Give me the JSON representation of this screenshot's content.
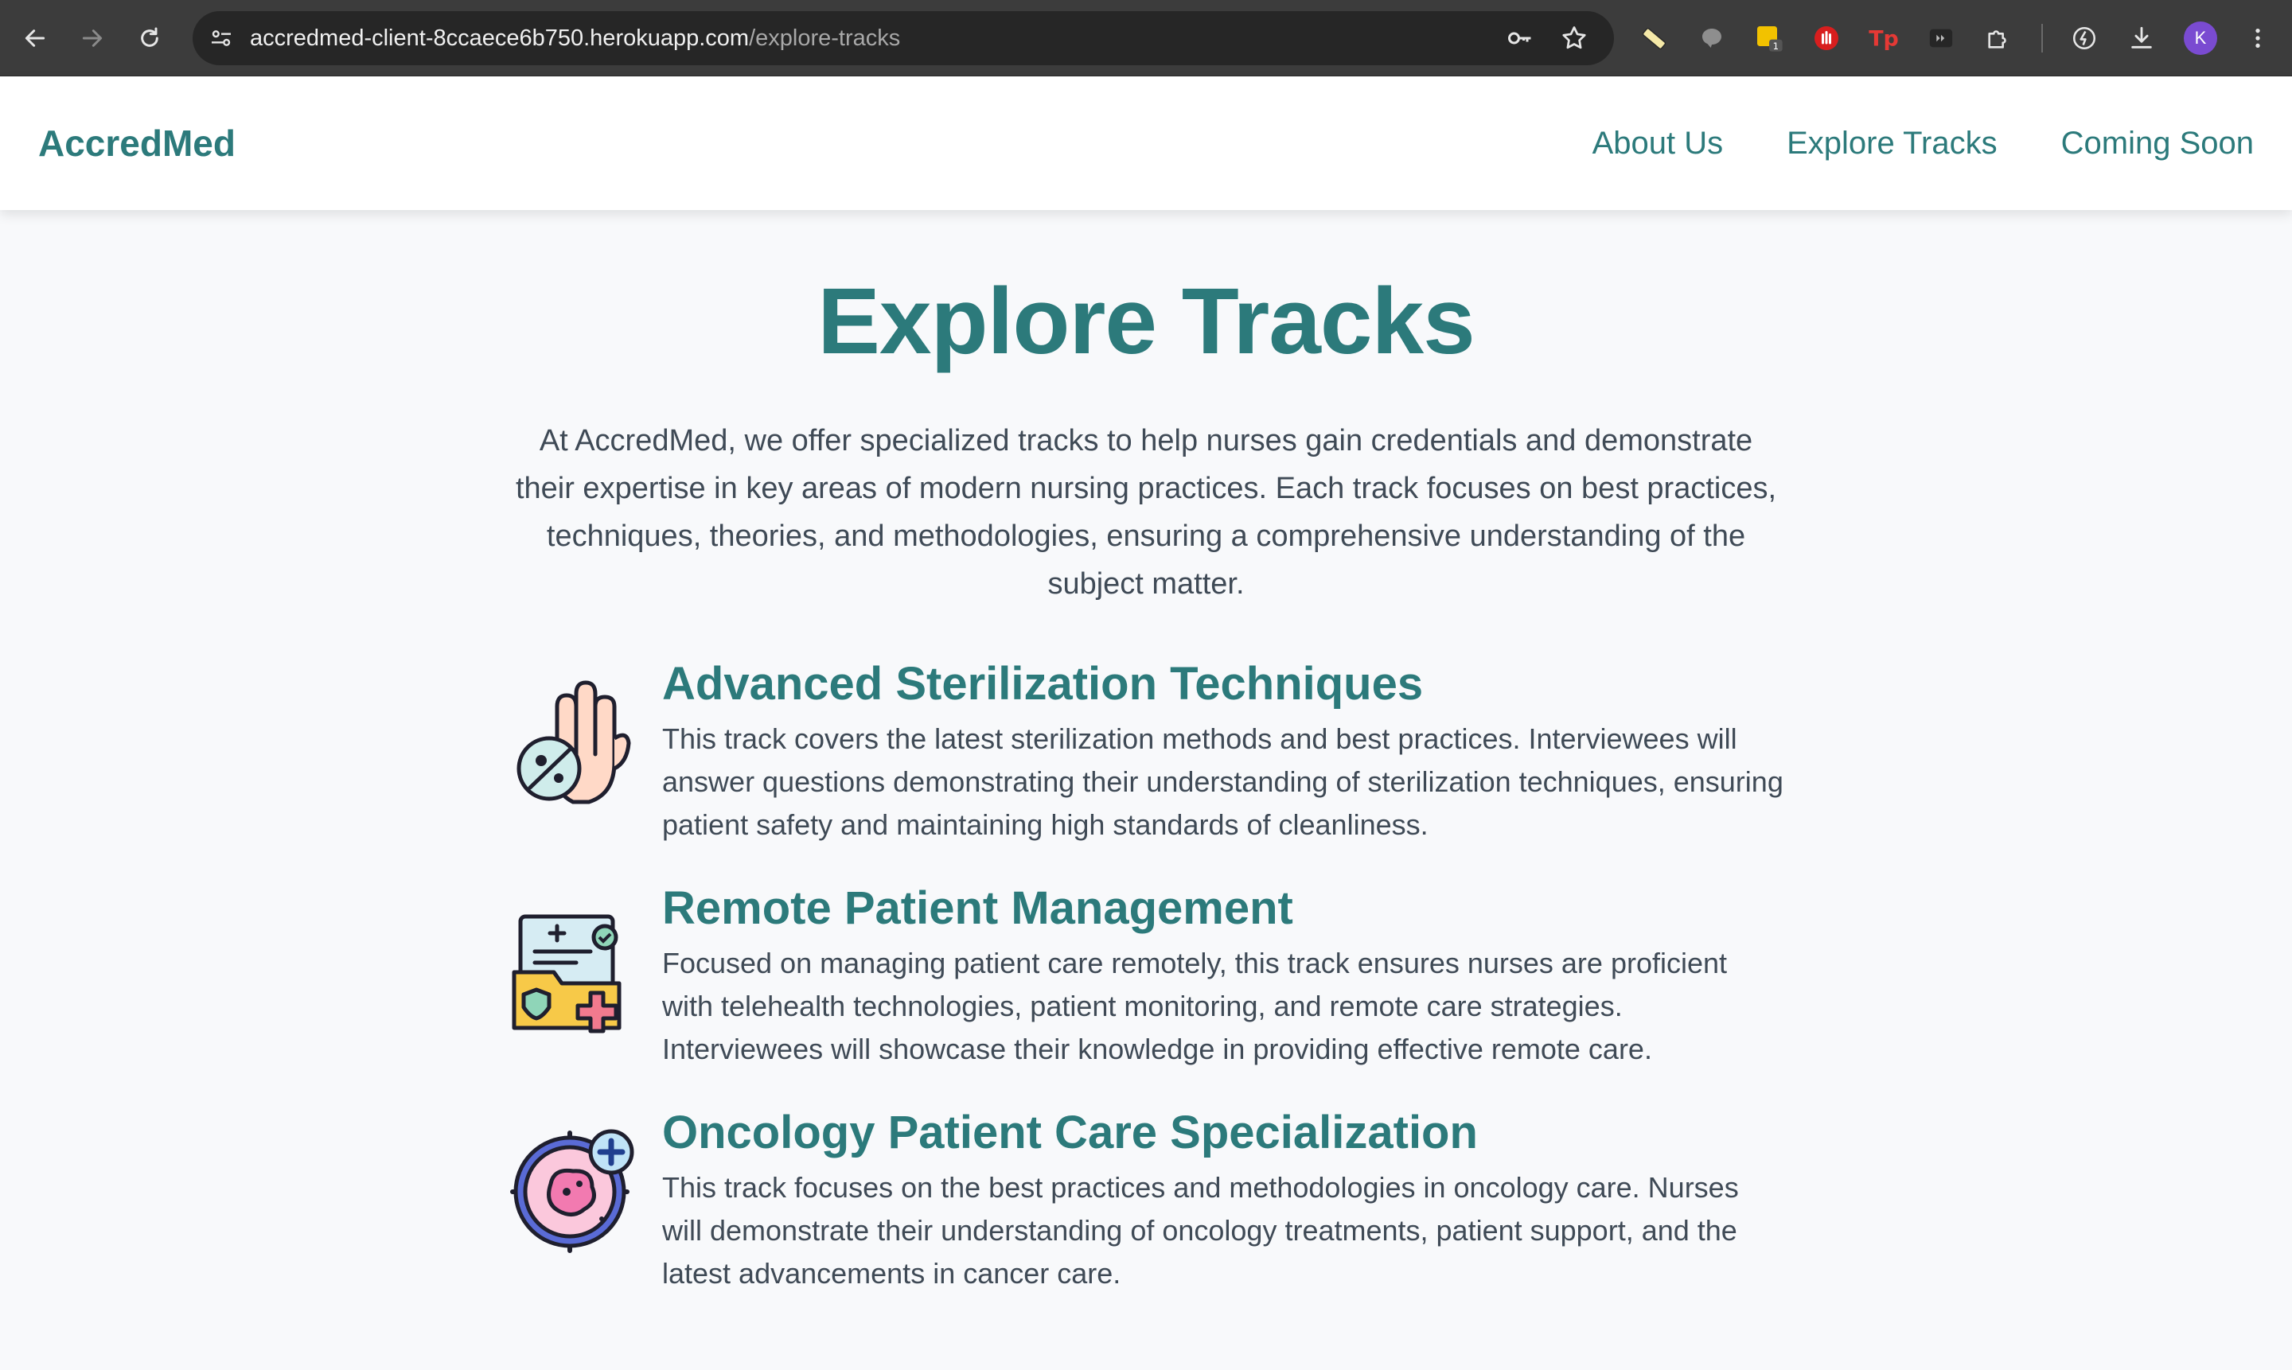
{
  "browser": {
    "url_host": "accredmed-client-8ccaece6b750.herokuapp.com",
    "url_path": "/explore-tracks",
    "extension_badge": "1",
    "profile_initial": "K"
  },
  "header": {
    "brand": "AccredMed",
    "nav": [
      "About Us",
      "Explore Tracks",
      "Coming Soon"
    ]
  },
  "page": {
    "title": "Explore Tracks",
    "intro": "At AccredMed, we offer specialized tracks to help nurses gain credentials and demonstrate their expertise in key areas of modern nursing practices. Each track focuses on best practices, techniques, theories, and methodologies, ensuring a comprehensive understanding of the subject matter."
  },
  "tracks": [
    {
      "icon": "sterile-hand-icon",
      "title": "Advanced Sterilization Techniques",
      "description": "This track covers the latest sterilization methods and best practices. Interviewees will answer questions demonstrating their understanding of sterilization techniques, ensuring patient safety and maintaining high standards of cleanliness."
    },
    {
      "icon": "medical-folder-icon",
      "title": "Remote Patient Management",
      "description": "Focused on managing patient care remotely, this track ensures nurses are proficient with telehealth technologies, patient monitoring, and remote care strategies. Interviewees will showcase their knowledge in providing effective remote care."
    },
    {
      "icon": "cell-target-icon",
      "title": "Oncology Patient Care Specialization",
      "description": "This track focuses on the best practices and methodologies in oncology care. Nurses will demonstrate their understanding of oncology treatments, patient support, and the latest advancements in cancer care."
    }
  ],
  "colors": {
    "accent": "#2c7a7b",
    "body_text": "#3f4a56",
    "page_bg": "#f8f9fb"
  }
}
